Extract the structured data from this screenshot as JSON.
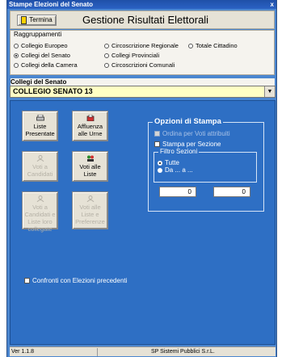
{
  "window": {
    "title": "Stampe Elezioni del Senato",
    "close_glyph": "x"
  },
  "toolbar": {
    "termina_label": "Termina",
    "app_title": "Gestione Risultati Elettorali"
  },
  "raggruppamenti": {
    "title": "Raggruppamenti",
    "options": [
      {
        "label": "Collegio Europeo",
        "selected": false
      },
      {
        "label": "Circoscrizione Regionale",
        "selected": false
      },
      {
        "label": "Totale Cittadino",
        "selected": false
      },
      {
        "label": "Collegi del Senato",
        "selected": true
      },
      {
        "label": "Collegi Provinciali",
        "selected": false
      },
      {
        "label": "Collegi della Camera",
        "selected": false
      },
      {
        "label": "Circoscrizioni Comunali",
        "selected": false
      }
    ]
  },
  "collegi": {
    "label": "Collegi del Senato",
    "selected": "COLLEGIO SENATO 13"
  },
  "buttons": {
    "liste_presentate": "Liste Presentate",
    "affluenza": "Affluenza alle Urne",
    "voti_candidati": "Voti a Candidati",
    "voti_liste": "Voti alle Liste",
    "voti_candidati_liste": "Voti a Candidati e Liste loro collegate",
    "voti_liste_preferenze": "Voti alle Liste e Preferenze"
  },
  "opzioni": {
    "title": "Opzioni di Stampa",
    "ordina": "Ordina per Voti attribuiti",
    "stampa_sezione": "Stampa per Sezione",
    "filtro_title": "Filtro Sezioni",
    "tutte": "Tutte",
    "da_a": "Da ... a ...",
    "da_value": "0",
    "a_value": "0"
  },
  "confronti": "Confronti con Elezioni precedenti",
  "status": {
    "version": "Ver 1.1.8",
    "company": "SP Sistemi Pubblici S.r.L."
  },
  "colors": {
    "panel": "#2e6fc4",
    "combo_bg": "#ffffc4"
  }
}
